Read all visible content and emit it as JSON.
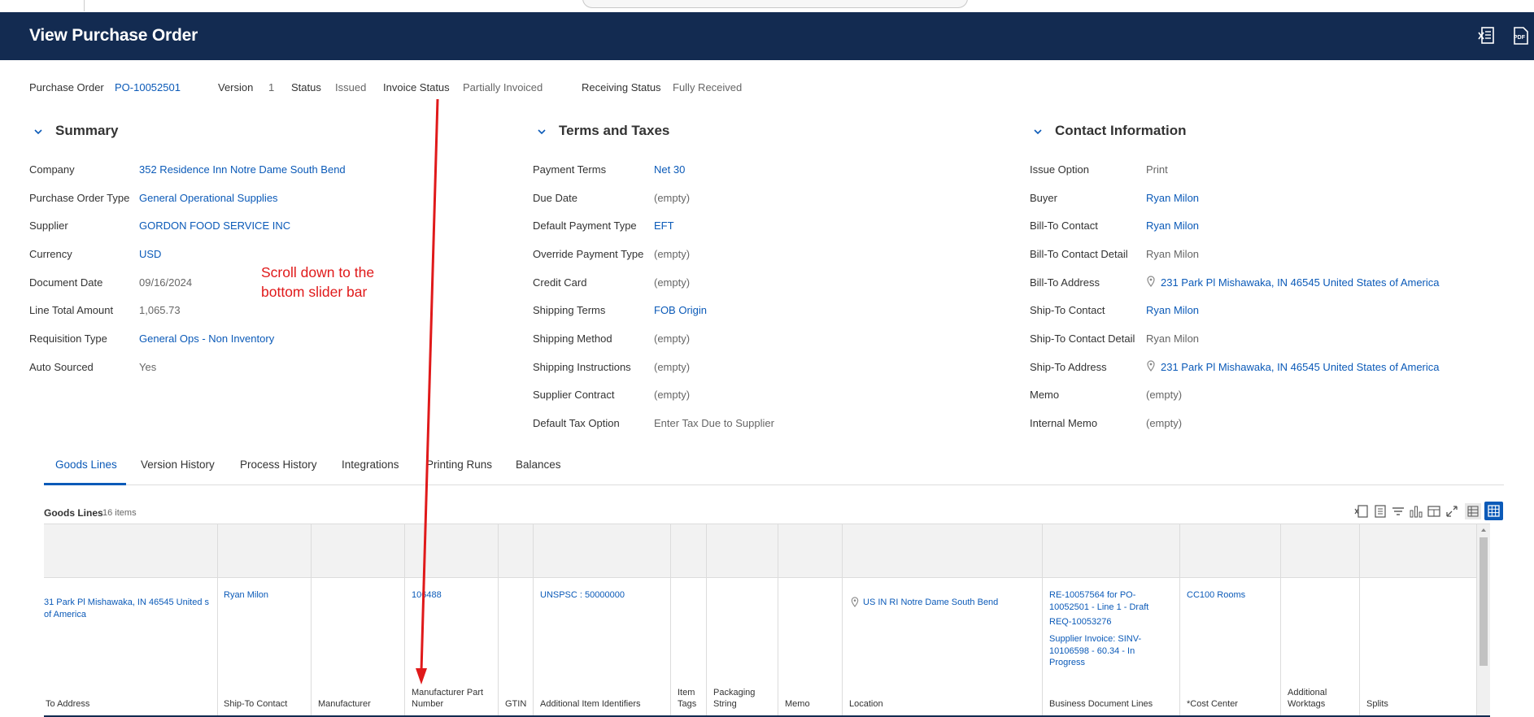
{
  "page": {
    "title": "View Purchase Order",
    "header_icons": [
      "export-excel-icon",
      "export-pdf-icon"
    ]
  },
  "status_row": {
    "po_label": "Purchase Order",
    "po_value": "PO-10052501",
    "version_label": "Version",
    "version_value": "1",
    "status_label": "Status",
    "status_value": "Issued",
    "invoice_status_label": "Invoice Status",
    "invoice_status_value": "Partially Invoiced",
    "receiving_status_label": "Receiving Status",
    "receiving_status_value": "Fully Received"
  },
  "summary": {
    "title": "Summary",
    "fields": [
      {
        "label": "Company",
        "value": "352 Residence Inn Notre Dame South Bend",
        "link": true
      },
      {
        "label": "Purchase Order Type",
        "value": "General Operational Supplies",
        "link": true
      },
      {
        "label": "Supplier",
        "value": "GORDON FOOD SERVICE INC",
        "link": true
      },
      {
        "label": "Currency",
        "value": "USD",
        "link": true
      },
      {
        "label": "Document Date",
        "value": "09/16/2024",
        "link": false
      },
      {
        "label": "Line Total Amount",
        "value": "1,065.73",
        "link": false
      },
      {
        "label": "Requisition Type",
        "value": "General Ops - Non Inventory",
        "link": true
      },
      {
        "label": "Auto Sourced",
        "value": "Yes",
        "link": false
      }
    ]
  },
  "terms": {
    "title": "Terms and Taxes",
    "fields": [
      {
        "label": "Payment Terms",
        "value": "Net 30",
        "link": true
      },
      {
        "label": "Due Date",
        "value": "(empty)",
        "link": false
      },
      {
        "label": "Default Payment Type",
        "value": "EFT",
        "link": true
      },
      {
        "label": "Override Payment Type",
        "value": "(empty)",
        "link": false
      },
      {
        "label": "Credit Card",
        "value": "(empty)",
        "link": false
      },
      {
        "label": "Shipping Terms",
        "value": "FOB Origin",
        "link": true
      },
      {
        "label": "Shipping Method",
        "value": "(empty)",
        "link": false
      },
      {
        "label": "Shipping Instructions",
        "value": "(empty)",
        "link": false
      },
      {
        "label": "Supplier Contract",
        "value": "(empty)",
        "link": false
      },
      {
        "label": "Default Tax Option",
        "value": "Enter Tax Due to Supplier",
        "link": false
      }
    ]
  },
  "contact": {
    "title": "Contact Information",
    "fields": [
      {
        "label": "Issue Option",
        "value": "Print",
        "link": false
      },
      {
        "label": "Buyer",
        "value": "Ryan Milon",
        "link": true
      },
      {
        "label": "Bill-To Contact",
        "value": "Ryan Milon",
        "link": true
      },
      {
        "label": "Bill-To Contact Detail",
        "value": "Ryan Milon",
        "link": false
      },
      {
        "label": "Bill-To Address",
        "value": "231 Park Pl Mishawaka, IN 46545 United States of America",
        "link": true,
        "pin": true
      },
      {
        "label": "Ship-To Contact",
        "value": "Ryan Milon",
        "link": true
      },
      {
        "label": "Ship-To Contact Detail",
        "value": "Ryan Milon",
        "link": false
      },
      {
        "label": "Ship-To Address",
        "value": "231 Park Pl Mishawaka, IN 46545 United States of America",
        "link": true,
        "pin": true
      },
      {
        "label": "Memo",
        "value": "(empty)",
        "link": false
      },
      {
        "label": "Internal Memo",
        "value": "(empty)",
        "link": false
      }
    ]
  },
  "tabs": [
    "Goods Lines",
    "Version History",
    "Process History",
    "Integrations",
    "Printing Runs",
    "Balances"
  ],
  "grid": {
    "title": "Goods Lines",
    "count": "16 items",
    "columns": [
      "To Address",
      "Ship-To Contact",
      "Manufacturer",
      "Manufacturer Part Number",
      "GTIN",
      "Additional Item Identifiers",
      "Item Tags",
      "Packaging String",
      "Memo",
      "Location",
      "Business Document Lines",
      "*Cost Center",
      "Additional Worktags",
      "Splits"
    ],
    "row": {
      "to_address": "31 Park Pl Mishawaka, IN 46545 United s of America",
      "ship_to_contact": "Ryan Milon",
      "manufacturer_part_number": "106488",
      "additional_item_identifiers": "UNSPSC : 50000000",
      "location": "US IN RI Notre Dame South Bend",
      "business_document_lines": [
        "RE-10057564 for PO-10052501 - Line 1 - Draft",
        "REQ-10053276",
        "Supplier Invoice: SINV-10106598 - 60.34 - In Progress"
      ],
      "cost_center": "CC100 Rooms"
    }
  },
  "annotation": {
    "line1": "Scroll down to the",
    "line2": "bottom slider bar"
  },
  "colors": {
    "header": "#132b51",
    "link": "#0b5ab8",
    "annotation": "#e0191a"
  }
}
